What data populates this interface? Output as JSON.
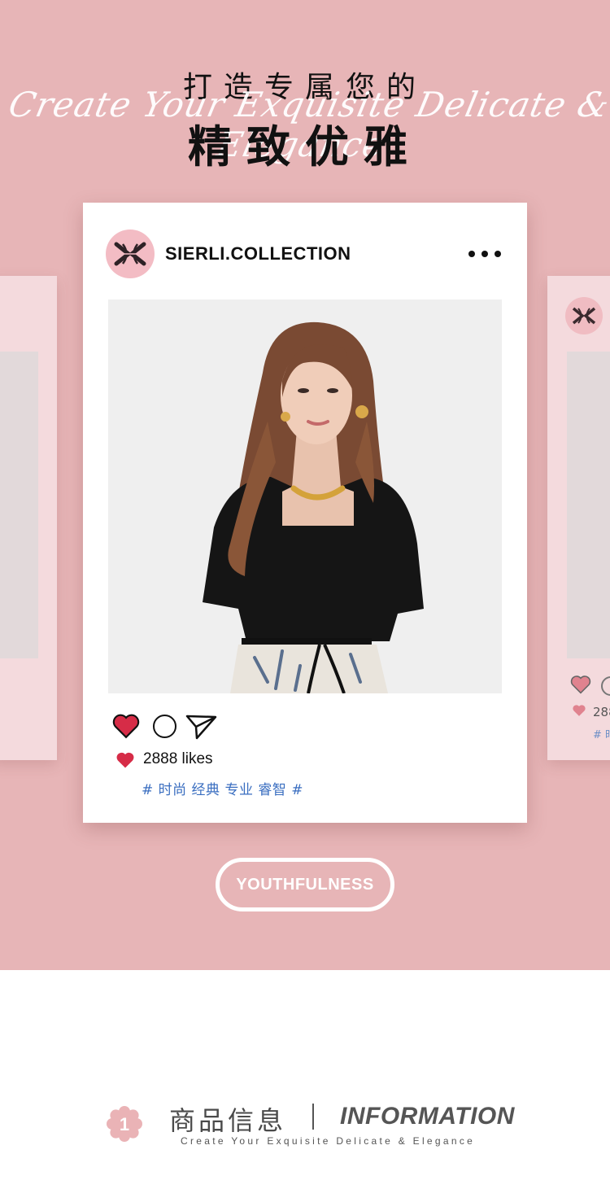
{
  "hero": {
    "headline_top": "打造专属您的",
    "script_line": "Create Your Exquisite Delicate & Elegance",
    "headline_main": "精致优雅",
    "background": "#e7b5b7"
  },
  "post": {
    "brand_name": "SIERLI.COLLECTION",
    "likes_text": "2888 likes",
    "tags": "# 时尚 经典 专业 睿智 #",
    "heart_color": "#d62c47",
    "tag_color": "#3a6ec0",
    "icons": [
      "brand-logo-icon",
      "more-icon",
      "heart-icon",
      "comment-icon",
      "send-icon"
    ]
  },
  "side_card_right": {
    "likes_text": "288",
    "tag_text": "# 时"
  },
  "cta": {
    "label": "YOUTHFULNESS"
  },
  "info": {
    "badge_number": "1",
    "title_cn": "商品信息",
    "title_en": "INFORMATION",
    "subtitle": "Create Your Exquisite Delicate & Elegance"
  }
}
